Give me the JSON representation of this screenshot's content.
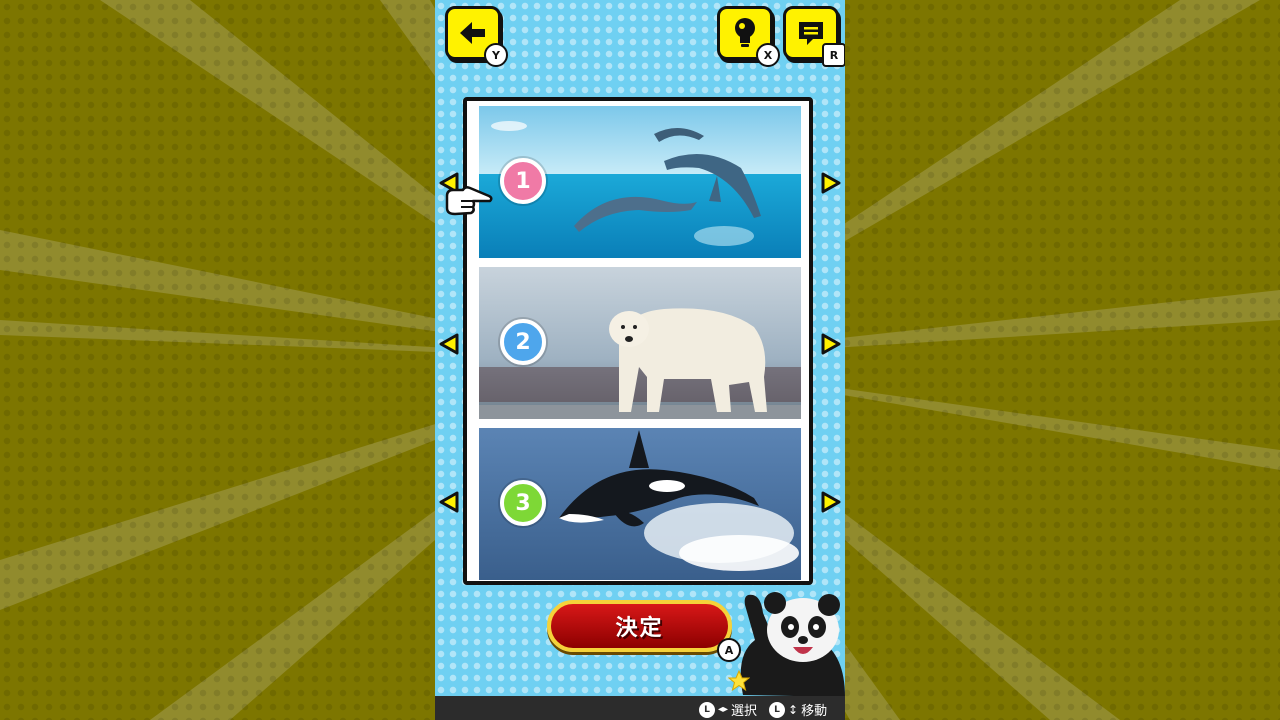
{
  "options": [
    {
      "number": "1",
      "animal": "dolphins",
      "badge_color": "#f07aa6"
    },
    {
      "number": "2",
      "animal": "polar-bear",
      "badge_color": "#4ea6ec"
    },
    {
      "number": "3",
      "animal": "orca",
      "badge_color": "#7ed836"
    }
  ],
  "selected_option": 1,
  "buttons": {
    "back": {
      "icon": "back-arrow-icon",
      "key": "Y"
    },
    "hint": {
      "icon": "lightbulb-icon",
      "key": "X"
    },
    "messages": {
      "icon": "message-icon",
      "key": "R"
    },
    "confirm": {
      "label": "決定",
      "key": "A"
    }
  },
  "footer": {
    "select_label": "選択",
    "move_label": "移動"
  },
  "colors": {
    "background": "#7d7600",
    "panel": "#6fd0f2",
    "accent": "#fff200",
    "confirm": "#c41010"
  }
}
